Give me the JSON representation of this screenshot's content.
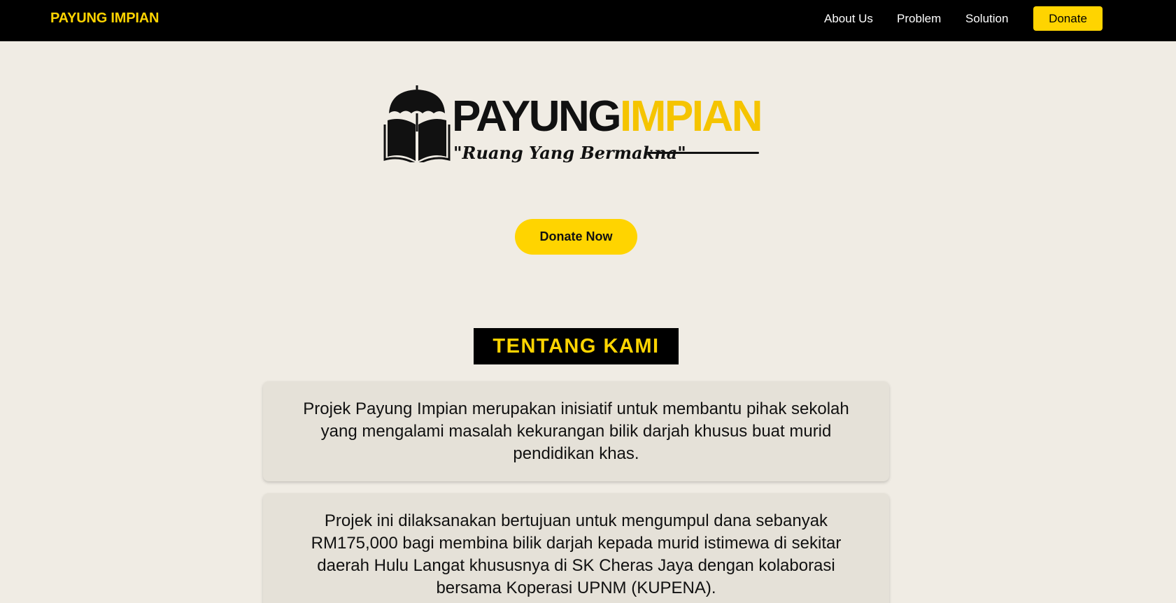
{
  "navbar": {
    "brand": "PAYUNG IMPIAN",
    "links": [
      {
        "label": "About Us"
      },
      {
        "label": "Problem"
      },
      {
        "label": "Solution"
      }
    ],
    "donate_label": "Donate"
  },
  "hero": {
    "logo": {
      "word_part1": "PAYUNG",
      "word_part2": "IMPIAN",
      "tagline": "\"Ruang Yang Bermakna\""
    },
    "cta_label": "Donate Now"
  },
  "about": {
    "title": "TENTANG KAMI",
    "paragraphs": [
      "Projek Payung Impian merupakan inisiatif untuk membantu pihak sekolah yang mengalami masalah kekurangan bilik darjah khusus buat murid pendidikan khas.",
      "Projek ini dilaksanakan bertujuan untuk mengumpul dana sebanyak RM175,000 bagi membina bilik darjah kepada murid istimewa di sekitar daerah Hulu Langat khususnya di SK Cheras Jaya dengan kolaborasi bersama Koperasi UPNM (KUPENA)."
    ]
  },
  "colors": {
    "accent": "#ffd400",
    "navbar_bg": "#000000",
    "page_bg": "#f0ece4",
    "card_bg": "#e5e1d8"
  }
}
